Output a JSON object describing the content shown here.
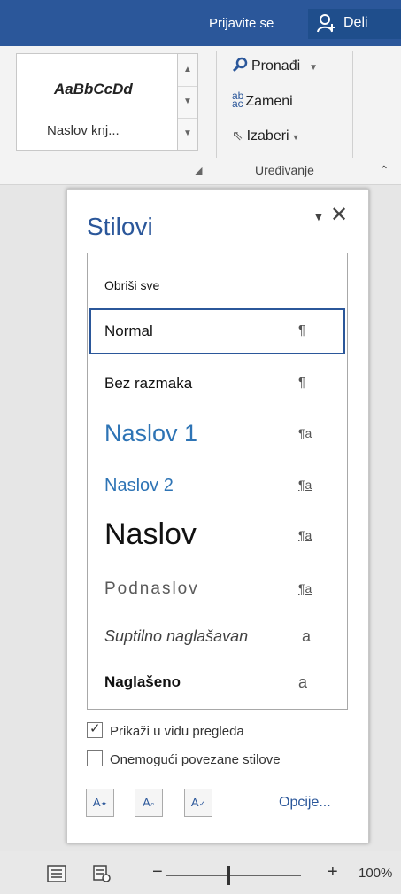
{
  "titlebar": {
    "signin": "Prijavite se",
    "share": "Deli"
  },
  "ribbon": {
    "gallery_sample": "AaBbCcDd",
    "gallery_name": "Naslov knj...",
    "find": "Pronađi",
    "replace": "Zameni",
    "select": "Izaberi",
    "group_label": "Uređivanje"
  },
  "pane": {
    "title": "Stilovi",
    "styles": [
      {
        "label": "Obriši sve",
        "marker": ""
      },
      {
        "label": "Normal",
        "marker": "¶"
      },
      {
        "label": "Bez razmaka",
        "marker": "¶"
      },
      {
        "label": "Naslov 1",
        "marker": "¶a"
      },
      {
        "label": "Naslov 2",
        "marker": "¶a"
      },
      {
        "label": "Naslov",
        "marker": "¶a"
      },
      {
        "label": "Podnaslov",
        "marker": "¶a"
      },
      {
        "label": "Suptilno naglašavan",
        "marker": "a"
      },
      {
        "label": "Naglašeno",
        "marker": "a"
      }
    ],
    "selected_style": "Normal",
    "show_preview": {
      "label": "Prikaži u vidu pregleda",
      "checked": true
    },
    "disable_linked": {
      "label": "Onemogući povezane stilove",
      "checked": false
    },
    "options_link": "Opcije..."
  },
  "status": {
    "zoom": "100%"
  },
  "colors": {
    "accent": "#2b579a",
    "heading": "#2e74b5"
  },
  "icons": [
    "person-add-icon",
    "search-icon",
    "replace-icon",
    "cursor-icon",
    "close-icon",
    "new-style-icon",
    "style-inspector-icon",
    "manage-styles-icon",
    "print-layout-icon",
    "web-layout-icon"
  ]
}
